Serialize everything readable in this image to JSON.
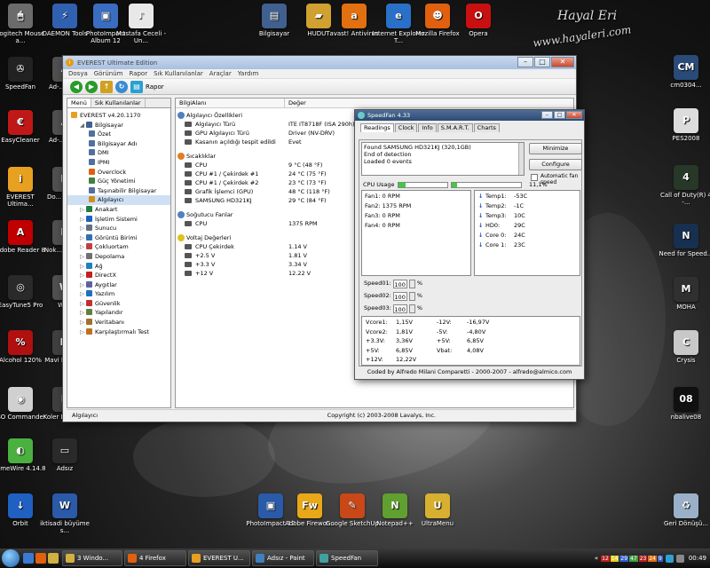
{
  "watermark": {
    "line1": "Hayal Eri",
    "line2": "www.hayaleri.com"
  },
  "desktop_icons_left": [
    {
      "label": "Logitech Mouse a...",
      "color": "#6b6b6b",
      "glyph": "🖱"
    },
    {
      "label": "SpeedFan",
      "color": "#222222",
      "glyph": "✇"
    },
    {
      "label": "EasyCleaner",
      "color": "#c01818",
      "glyph": "€"
    },
    {
      "label": "EVEREST Ultima...",
      "color": "#e8a020",
      "glyph": "i"
    },
    {
      "label": "Adobe Reader 8",
      "color": "#c00000",
      "glyph": "A"
    },
    {
      "label": "EasyTune5 Pro",
      "color": "#2a2a2a",
      "glyph": "◎"
    },
    {
      "label": "Alcohol 120%",
      "color": "#b01010",
      "glyph": "%"
    },
    {
      "label": "ISO Commander",
      "color": "#d0d0d0",
      "glyph": "◉"
    },
    {
      "label": "LimeWire 4.14.8",
      "color": "#4ab040",
      "glyph": "◐"
    },
    {
      "label": "Orbit",
      "color": "#2060c0",
      "glyph": "↓"
    }
  ],
  "desktop_icons_col2": [
    {
      "label": "DAEMON Tools",
      "color": "#3060b0",
      "glyph": "⚡"
    },
    {
      "label": "Ad-... 20...",
      "color": "#505050",
      "glyph": "A"
    },
    {
      "label": "Ad-... 20...",
      "color": "#505050",
      "glyph": "A"
    },
    {
      "label": "Do... Ceci...",
      "color": "#505050",
      "glyph": "D"
    },
    {
      "label": "Nok... Start...",
      "color": "#505050",
      "glyph": "N"
    },
    {
      "label": "Wi...",
      "color": "#505050",
      "glyph": "W"
    },
    {
      "label": "Mavi İyi Du...",
      "color": "#404040",
      "glyph": "M"
    },
    {
      "label": "Koler Dibe L...",
      "color": "#404040",
      "glyph": "K"
    },
    {
      "label": "Adsız",
      "color": "#2a2a2a",
      "glyph": "▭"
    },
    {
      "label": "iktisadi büyüme s...",
      "color": "#2a5aa8",
      "glyph": "W"
    }
  ],
  "desktop_icons_top": [
    {
      "label": "PhotoImpact Album 12",
      "color": "#3a6cc0",
      "glyph": "▣"
    },
    {
      "label": "Mustafa Ceceli - Un...",
      "color": "#e8e8e8",
      "glyph": "♪"
    },
    {
      "label": "Bilgisayar",
      "color": "#406090",
      "glyph": "▤"
    },
    {
      "label": "HUDUT",
      "color": "#d0a030",
      "glyph": "▰"
    },
    {
      "label": "avast! Antivirus",
      "color": "#e07010",
      "glyph": "a"
    },
    {
      "label": "Internet Explorer T...",
      "color": "#2a70c8",
      "glyph": "e"
    },
    {
      "label": "Mozilla Firefox",
      "color": "#e06010",
      "glyph": "☻"
    },
    {
      "label": "Opera",
      "color": "#c81010",
      "glyph": "O"
    }
  ],
  "desktop_icons_right": [
    {
      "label": "cm0304...",
      "color": "#2a4a78",
      "glyph": "CM"
    },
    {
      "label": "PES2008",
      "color": "#dcdcdc",
      "glyph": "P"
    },
    {
      "label": "Call of Duty(R) 4 -...",
      "color": "#283828",
      "glyph": "4"
    },
    {
      "label": "Need for Speed...",
      "color": "#183050",
      "glyph": "N"
    },
    {
      "label": "MOHA",
      "color": "#303030",
      "glyph": "M"
    },
    {
      "label": "Crysis",
      "color": "#c8c8c8",
      "glyph": "C"
    },
    {
      "label": "nbalive08",
      "color": "#101010",
      "glyph": "08"
    },
    {
      "label": "Geri Dönüşü...",
      "color": "#9ab0c8",
      "glyph": "♻"
    }
  ],
  "desktop_icons_bottom": [
    {
      "label": "PhotoImpact 12",
      "color": "#2a5aa8",
      "glyph": "▣"
    },
    {
      "label": "Adobe Firewor...",
      "color": "#e8a818",
      "glyph": "Fw"
    },
    {
      "label": "Google SketchUp",
      "color": "#c84818",
      "glyph": "✎"
    },
    {
      "label": "Notepad++",
      "color": "#60a030",
      "glyph": "N"
    },
    {
      "label": "UltraMenu",
      "color": "#d8b030",
      "glyph": "U"
    }
  ],
  "everest": {
    "title": "EVEREST Ultimate Edition",
    "menu": [
      "Dosya",
      "Görünüm",
      "Rapor",
      "Sık Kullanılanlar",
      "Araçlar",
      "Yardım"
    ],
    "toolbar_label": "Rapor",
    "tabs": [
      "Menü",
      "Sık Kullanılanlar"
    ],
    "tree": [
      {
        "label": "EVEREST v4.20.1170",
        "lvl": 0,
        "color": "#e8a020"
      },
      {
        "label": "Bilgisayar",
        "lvl": 1,
        "color": "#406090"
      },
      {
        "label": "Özet",
        "lvl": 2,
        "color": "#5070a0"
      },
      {
        "label": "Bilgisayar Adı",
        "lvl": 2,
        "color": "#5070a0"
      },
      {
        "label": "DMI",
        "lvl": 2,
        "color": "#5070a0"
      },
      {
        "label": "IPMI",
        "lvl": 2,
        "color": "#5070a0"
      },
      {
        "label": "Overclock",
        "lvl": 2,
        "color": "#e06010"
      },
      {
        "label": "Güç Yönetimi",
        "lvl": 2,
        "color": "#408040"
      },
      {
        "label": "Taşınabilir Bilgisayar",
        "lvl": 2,
        "color": "#5070a0"
      },
      {
        "label": "Algılayıcı",
        "lvl": 2,
        "color": "#d09020",
        "selected": true
      },
      {
        "label": "Anakart",
        "lvl": 1,
        "color": "#208040"
      },
      {
        "label": "İşletim Sistemi",
        "lvl": 1,
        "color": "#2060c0"
      },
      {
        "label": "Sunucu",
        "lvl": 1,
        "color": "#607080"
      },
      {
        "label": "Görüntü Birimi",
        "lvl": 1,
        "color": "#3070b0"
      },
      {
        "label": "Çokluortam",
        "lvl": 1,
        "color": "#c04040"
      },
      {
        "label": "Depolama",
        "lvl": 1,
        "color": "#707070"
      },
      {
        "label": "Ağ",
        "lvl": 1,
        "color": "#2080c0"
      },
      {
        "label": "DirectX",
        "lvl": 1,
        "color": "#c02020"
      },
      {
        "label": "Aygıtlar",
        "lvl": 1,
        "color": "#6060a0"
      },
      {
        "label": "Yazılım",
        "lvl": 1,
        "color": "#2070c0"
      },
      {
        "label": "Güvenlik",
        "lvl": 1,
        "color": "#c03030"
      },
      {
        "label": "Yapılandır",
        "lvl": 1,
        "color": "#608040"
      },
      {
        "label": "Veritabanı",
        "lvl": 1,
        "color": "#a07030"
      },
      {
        "label": "Karşılaştırmalı Test",
        "lvl": 1,
        "color": "#c07020"
      }
    ],
    "columns": [
      "BilgiAlanı",
      "Değer"
    ],
    "rows": [
      {
        "type": "section",
        "k": "Algılayıcı Özellikleri",
        "color": "#5080c0"
      },
      {
        "k": "Algılayıcı Türü",
        "v": "ITE IT8718F  (ISA 290h)"
      },
      {
        "k": "GPU Algılayıcı Türü",
        "v": "Driver  (NV-DRV)"
      },
      {
        "k": "Kasanın açıldığı tespit edildi",
        "v": "Evet"
      },
      {
        "type": "gap"
      },
      {
        "type": "section",
        "k": "Sıcaklıklar",
        "color": "#e08020"
      },
      {
        "k": "CPU",
        "v": "9 °C  (48 °F)"
      },
      {
        "k": "CPU #1 / Çekirdek #1",
        "v": "24 °C  (75 °F)"
      },
      {
        "k": "CPU #1 / Çekirdek #2",
        "v": "23 °C  (73 °F)"
      },
      {
        "k": "Grafik İşlemci (GPU)",
        "v": "48 °C  (118 °F)"
      },
      {
        "k": "SAMSUNG HD321KJ",
        "v": "29 °C  (84 °F)"
      },
      {
        "type": "gap"
      },
      {
        "type": "section",
        "k": "Soğutucu Fanlar",
        "color": "#5080c0"
      },
      {
        "k": "CPU",
        "v": "1375 RPM"
      },
      {
        "type": "gap"
      },
      {
        "type": "section",
        "k": "Voltaj Değerleri",
        "color": "#e0c020"
      },
      {
        "k": "CPU Çekirdek",
        "v": "1.14 V"
      },
      {
        "k": "+2.5 V",
        "v": "1.81 V"
      },
      {
        "k": "+3.3 V",
        "v": "3.34 V"
      },
      {
        "k": "+12 V",
        "v": "12.22 V"
      }
    ],
    "status_left": "Algılayıcı",
    "status_right": "Copyright (c) 2003-2008 Lavalys, Inc."
  },
  "speedfan": {
    "title": "SpeedFan 4.33",
    "tabs": [
      "Readings",
      "Clock",
      "Info",
      "S.M.A.R.T.",
      "Charts"
    ],
    "log": [
      "Found SAMSUNG HD321KJ (320,1GB)",
      "End of detection",
      "Loaded 0 events"
    ],
    "minimize": "Minimize",
    "configure": "Configure",
    "auto_fan": "Automatic fan speed",
    "cpu_usage_label": "CPU Usage",
    "cpu_usage_value": "11,1%",
    "cpu_usage_bars": [
      0.14,
      0.08
    ],
    "fans": [
      "Fan1: 0 RPM",
      "Fan2: 1375 RPM",
      "Fan3: 0 RPM",
      "Fan4: 0 RPM"
    ],
    "temps": [
      {
        "n": "Temp1:",
        "v": "-53C"
      },
      {
        "n": "Temp2:",
        "v": "-1C"
      },
      {
        "n": "Temp3:",
        "v": "10C"
      },
      {
        "n": "HD0:",
        "v": "29C"
      },
      {
        "n": "Core 0:",
        "v": "24C"
      },
      {
        "n": "Core 1:",
        "v": "23C"
      }
    ],
    "speeds": [
      {
        "label": "Speed01:",
        "value": "100",
        "unit": "%"
      },
      {
        "label": "Speed02:",
        "value": "100",
        "unit": "%"
      },
      {
        "label": "Speed03:",
        "value": "100",
        "unit": "%"
      }
    ],
    "volts_left": [
      {
        "n": "Vcore1:",
        "v": "1,15V"
      },
      {
        "n": "Vcore2:",
        "v": "1,81V"
      },
      {
        "n": "+3.3V:",
        "v": "3,36V"
      },
      {
        "n": "+5V:",
        "v": "6,85V"
      },
      {
        "n": "+12V:",
        "v": "12,22V"
      }
    ],
    "volts_right": [
      {
        "n": "-12V:",
        "v": "-16,97V"
      },
      {
        "n": "-5V:",
        "v": "-4,80V"
      },
      {
        "n": "+5V:",
        "v": "6,85V"
      },
      {
        "n": "Vbat:",
        "v": "4,08V"
      }
    ],
    "credit": "Coded by Alfredo Milani Comparetti - 2000-2007 - alfredo@almico.com"
  },
  "taskbar": {
    "buttons": [
      {
        "label": "3 Windo...",
        "color": "#d0b040"
      },
      {
        "label": "4 Firefox",
        "color": "#e06010"
      },
      {
        "label": "EVEREST U...",
        "color": "#e8a020"
      },
      {
        "label": "Adsız - Paint",
        "color": "#4080c0"
      },
      {
        "label": "SpeedFan",
        "color": "#40a0a0"
      }
    ],
    "tray_numbers": [
      "12",
      "14",
      "29",
      "47",
      "23",
      "24",
      "9"
    ],
    "clock": "00:49"
  }
}
